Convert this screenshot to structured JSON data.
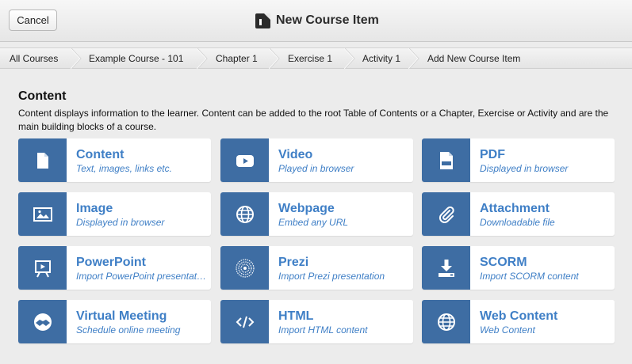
{
  "header": {
    "cancel_label": "Cancel",
    "title": "New Course Item",
    "title_icon": "new-item-icon"
  },
  "breadcrumb": [
    {
      "label": "All Courses"
    },
    {
      "label": "Example Course - 101"
    },
    {
      "label": "Chapter 1"
    },
    {
      "label": "Exercise 1"
    },
    {
      "label": "Activity 1"
    },
    {
      "label": "Add New Course Item"
    }
  ],
  "section": {
    "title": "Content",
    "description": "Content displays information to the learner. Content can be added to the root Table of Contents or a Chapter, Exercise or Activity and are the main building blocks of a course."
  },
  "items": [
    {
      "name": "Content",
      "subtitle": "Text, images, links etc.",
      "icon": "document-icon"
    },
    {
      "name": "Video",
      "subtitle": "Played in browser",
      "icon": "video-play-icon"
    },
    {
      "name": "PDF",
      "subtitle": "Displayed in browser",
      "icon": "pdf-icon"
    },
    {
      "name": "Image",
      "subtitle": "Displayed in browser",
      "icon": "image-icon"
    },
    {
      "name": "Webpage",
      "subtitle": "Embed any URL",
      "icon": "globe-icon"
    },
    {
      "name": "Attachment",
      "subtitle": "Downloadable file",
      "icon": "paperclip-icon"
    },
    {
      "name": "PowerPoint",
      "subtitle": "Import PowerPoint presentation",
      "icon": "presentation-icon"
    },
    {
      "name": "Prezi",
      "subtitle": "Import Prezi presentation",
      "icon": "prezi-icon"
    },
    {
      "name": "SCORM",
      "subtitle": "Import SCORM content",
      "icon": "download-icon"
    },
    {
      "name": "Virtual Meeting",
      "subtitle": "Schedule online meeting",
      "icon": "handshake-icon"
    },
    {
      "name": "HTML",
      "subtitle": "Import HTML content",
      "icon": "code-icon"
    },
    {
      "name": "Web Content",
      "subtitle": "Web Content",
      "icon": "globe-icon"
    }
  ],
  "colors": {
    "accent": "#3e6da3",
    "link": "#3f7fc6"
  }
}
